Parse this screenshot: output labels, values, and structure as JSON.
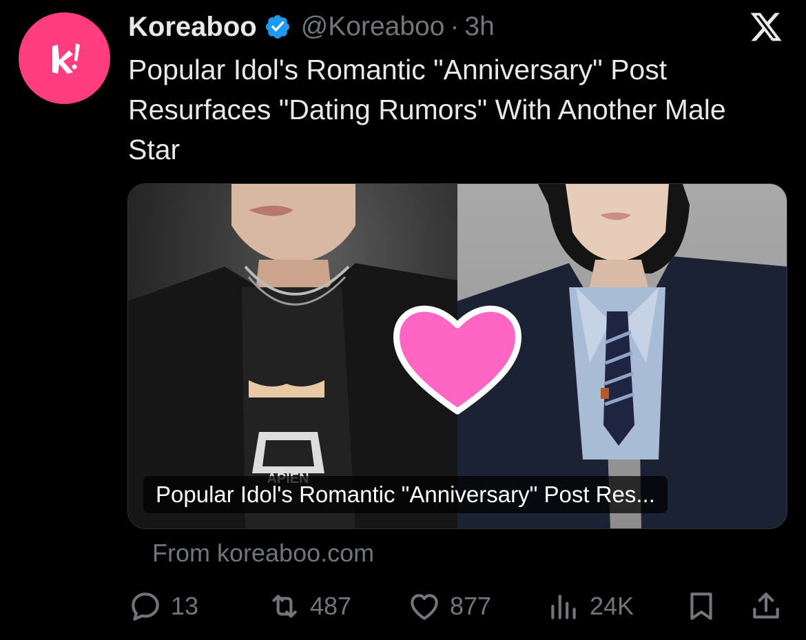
{
  "account": {
    "display_name": "Koreaboo",
    "handle": "@Koreaboo",
    "separator": "·",
    "time": "3h",
    "verified": true,
    "avatar_letter": "k!",
    "avatar_color": "#ff3d7f"
  },
  "platform_icon": "x-logo-icon",
  "tweet": {
    "text": "Popular Idol's Romantic \"Anniversary\" Post Resurfaces \"Dating Rumors\" With Another Male Star"
  },
  "card": {
    "title": "Popular Idol's Romantic \"Anniversary\" Post Res...",
    "source": "From koreaboo.com",
    "heart_color": "#ff66c4",
    "shirt_print": "APIEN"
  },
  "actions": {
    "replies": "13",
    "reposts": "487",
    "likes": "877",
    "views": "24K"
  },
  "colors": {
    "background": "#000000",
    "text_primary": "#e7e9ea",
    "text_secondary": "#71767b",
    "verified_blue": "#1d9bf0"
  }
}
